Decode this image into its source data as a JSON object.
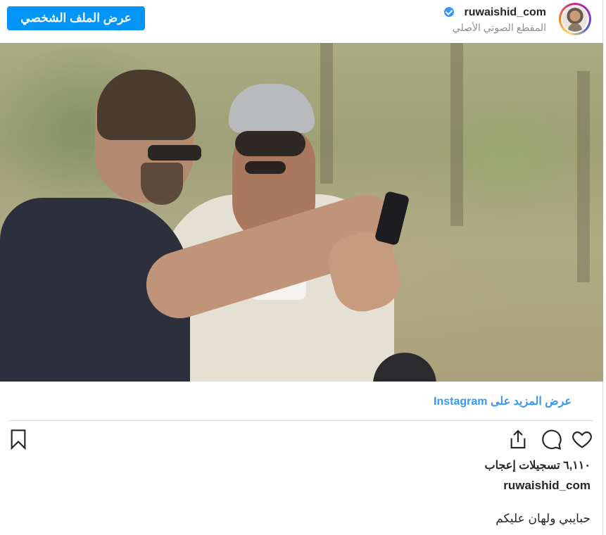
{
  "header": {
    "username": "ruwaishid_com",
    "subtitle": "المقطع الصوتي الأصلي",
    "view_profile_label": "عرض الملف الشخصي"
  },
  "post": {
    "more_link": "عرض المزيد على Instagram",
    "likes": "٦,١١٠ تسجيلات إعجاب",
    "caption_user": "ruwaishid_com",
    "caption_text": "حبايبي ولهان عليكم"
  },
  "icons": {
    "like": "heart-icon",
    "comment": "comment-icon",
    "share": "share-icon",
    "save": "bookmark-icon",
    "verified": "verified-badge-icon"
  },
  "colors": {
    "accent": "#0095f6",
    "link": "#3897f0",
    "text": "#262626",
    "muted": "#8e8e8e"
  }
}
